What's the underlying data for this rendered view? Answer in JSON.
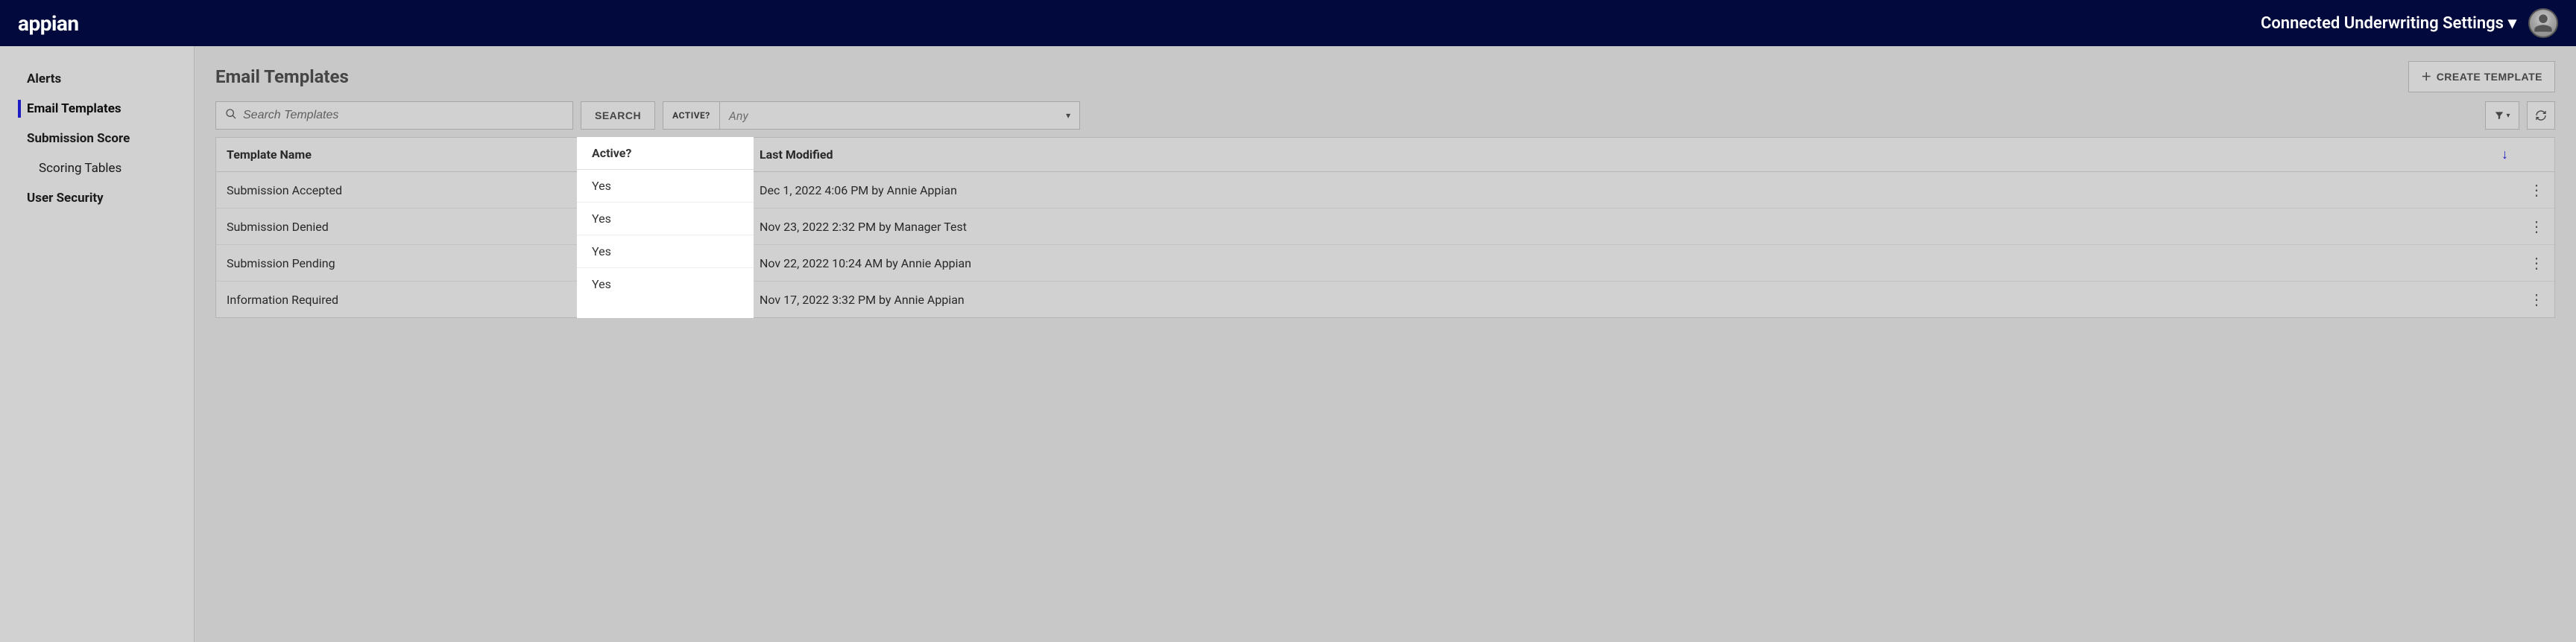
{
  "header": {
    "logo_text": "appian",
    "settings_label": "Connected Underwriting Settings"
  },
  "sidebar": {
    "items": [
      {
        "label": "Alerts",
        "active": false,
        "sub": false
      },
      {
        "label": "Email Templates",
        "active": true,
        "sub": false
      },
      {
        "label": "Submission Score",
        "active": false,
        "sub": false
      },
      {
        "label": "Scoring Tables",
        "active": false,
        "sub": true
      },
      {
        "label": "User Security",
        "active": false,
        "sub": false
      }
    ]
  },
  "page": {
    "title": "Email Templates",
    "create_button": "CREATE TEMPLATE"
  },
  "search": {
    "placeholder": "Search Templates",
    "button": "SEARCH",
    "filter_label": "ACTIVE?",
    "filter_value": "Any"
  },
  "table": {
    "columns": {
      "name": "Template Name",
      "active": "Active?",
      "modified": "Last Modified"
    },
    "rows": [
      {
        "name": "Submission Accepted",
        "active": "Yes",
        "modified": "Dec 1, 2022 4:06 PM by Annie Appian"
      },
      {
        "name": "Submission Denied",
        "active": "Yes",
        "modified": "Nov 23, 2022 2:32 PM by Manager Test"
      },
      {
        "name": "Submission Pending",
        "active": "Yes",
        "modified": "Nov 22, 2022 10:24 AM by Annie Appian"
      },
      {
        "name": "Information Required",
        "active": "Yes",
        "modified": "Nov 17, 2022 3:32 PM by Annie Appian"
      }
    ]
  }
}
